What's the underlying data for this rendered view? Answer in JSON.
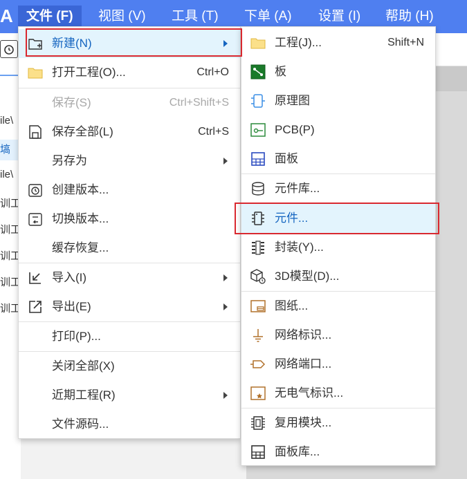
{
  "menubar": {
    "logo": "A",
    "items": [
      {
        "label": "文件 (F)"
      },
      {
        "label": "视图 (V)"
      },
      {
        "label": "工具 (T)"
      },
      {
        "label": "下单 (A)"
      },
      {
        "label": "设置 (I)"
      },
      {
        "label": "帮助 (H)"
      }
    ]
  },
  "background": {
    "left_items": [
      "ile\\",
      "塙",
      "ile\\",
      "训工",
      "训工",
      "训工",
      "训工",
      "训工"
    ]
  },
  "file_menu": {
    "items": [
      {
        "label": "新建(N)",
        "icon": "new-folder-icon",
        "submenu": true
      },
      {
        "label": "打开工程(O)...",
        "icon": "folder-icon",
        "shortcut": "Ctrl+O"
      },
      {
        "label": "保存(S)",
        "shortcut": "Ctrl+Shift+S",
        "disabled": true
      },
      {
        "label": "保存全部(L)",
        "icon": "save-icon",
        "shortcut": "Ctrl+S"
      },
      {
        "label": "另存为",
        "submenu": true
      },
      {
        "label": "创建版本...",
        "icon": "create-version-icon"
      },
      {
        "label": "切换版本...",
        "icon": "switch-version-icon"
      },
      {
        "label": "缓存恢复..."
      },
      {
        "label": "导入(I)",
        "icon": "import-icon",
        "submenu": true
      },
      {
        "label": "导出(E)",
        "icon": "export-icon",
        "submenu": true
      },
      {
        "label": "打印(P)..."
      },
      {
        "label": "关闭全部(X)"
      },
      {
        "label": "近期工程(R)",
        "submenu": true
      },
      {
        "label": "文件源码..."
      }
    ]
  },
  "new_submenu": {
    "items": [
      {
        "label": "工程(J)...",
        "icon": "folder-icon",
        "shortcut": "Shift+N"
      },
      {
        "label": "板",
        "icon": "board-icon"
      },
      {
        "label": "原理图",
        "icon": "schematic-icon"
      },
      {
        "label": "PCB(P)",
        "icon": "pcb-icon"
      },
      {
        "label": "面板",
        "icon": "panel-icon"
      },
      {
        "label": "元件库...",
        "icon": "component-library-icon"
      },
      {
        "label": "元件...",
        "icon": "component-icon"
      },
      {
        "label": "封装(Y)...",
        "icon": "footprint-icon"
      },
      {
        "label": "3D模型(D)...",
        "icon": "3d-model-icon"
      },
      {
        "label": "图纸...",
        "icon": "drawing-sheet-icon"
      },
      {
        "label": "网络标识...",
        "icon": "net-flag-icon"
      },
      {
        "label": "网络端口...",
        "icon": "net-port-icon"
      },
      {
        "label": "无电气标识...",
        "icon": "non-electrical-flag-icon"
      },
      {
        "label": "复用模块...",
        "icon": "reuse-block-icon"
      },
      {
        "label": "面板库...",
        "icon": "panel-library-icon"
      }
    ]
  },
  "colors": {
    "menubar_bg": "#4f7ff0",
    "highlight_bg": "#e3f4fd",
    "highlight_text": "#1565c0",
    "red_outline": "#d9282f",
    "disabled_text": "#a8a8a8"
  }
}
